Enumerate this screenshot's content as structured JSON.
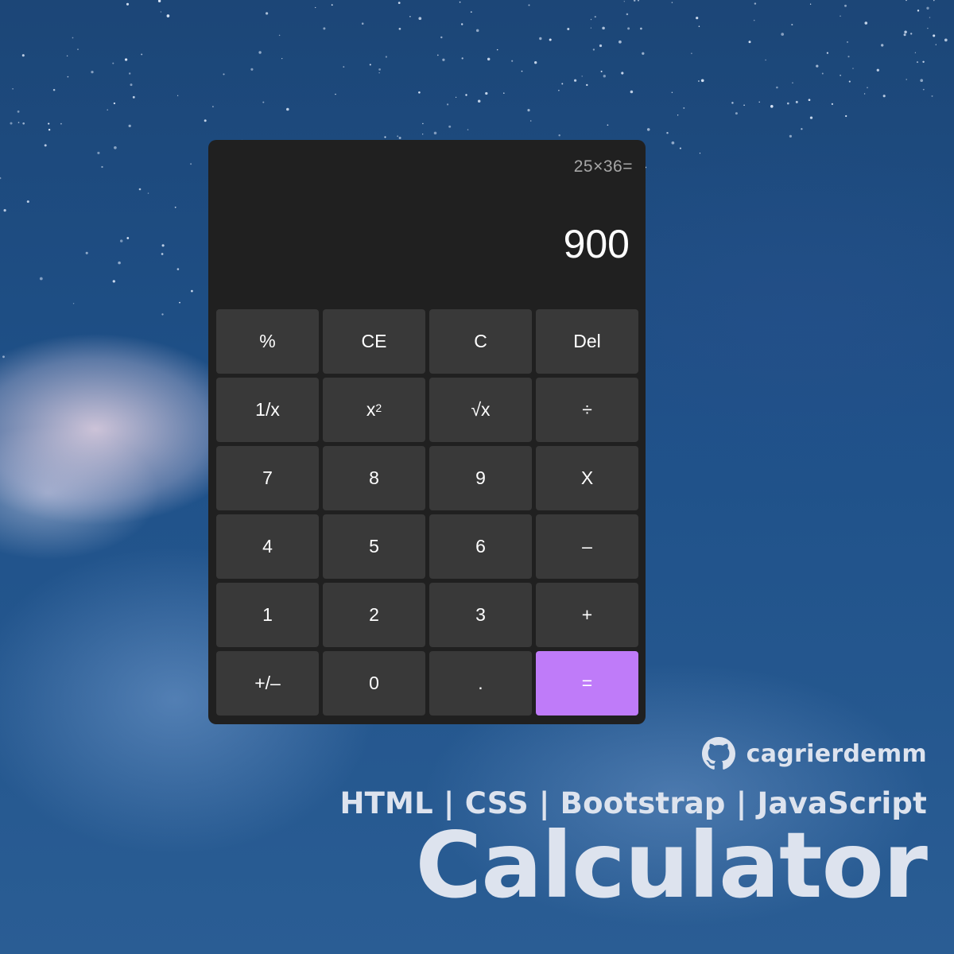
{
  "calculator": {
    "expression": "25×36=",
    "result": "900",
    "keys": [
      {
        "label": "%",
        "name": "percent"
      },
      {
        "label": "CE",
        "name": "clear-entry"
      },
      {
        "label": "C",
        "name": "clear"
      },
      {
        "label": "Del",
        "name": "delete"
      },
      {
        "label": "1/x",
        "name": "reciprocal"
      },
      {
        "label": "x",
        "sup": "2",
        "name": "square"
      },
      {
        "label": "√x",
        "name": "square-root"
      },
      {
        "label": "÷",
        "name": "divide"
      },
      {
        "label": "7",
        "name": "digit-7"
      },
      {
        "label": "8",
        "name": "digit-8"
      },
      {
        "label": "9",
        "name": "digit-9"
      },
      {
        "label": "X",
        "name": "multiply"
      },
      {
        "label": "4",
        "name": "digit-4"
      },
      {
        "label": "5",
        "name": "digit-5"
      },
      {
        "label": "6",
        "name": "digit-6"
      },
      {
        "label": "–",
        "name": "subtract"
      },
      {
        "label": "1",
        "name": "digit-1"
      },
      {
        "label": "2",
        "name": "digit-2"
      },
      {
        "label": "3",
        "name": "digit-3"
      },
      {
        "label": "+",
        "name": "add"
      },
      {
        "label": "+/–",
        "name": "negate"
      },
      {
        "label": "0",
        "name": "digit-0"
      },
      {
        "label": ".",
        "name": "decimal"
      },
      {
        "label": "=",
        "name": "equals"
      }
    ]
  },
  "credits": {
    "author": "cagrierdemm",
    "author_icon": "github-icon",
    "tech_stack": "HTML | CSS | Bootstrap | JavaScript",
    "title": "Calculator"
  },
  "colors": {
    "calculator_bg": "#202020",
    "key_bg": "#393939",
    "equals_accent": "#bf7bf9",
    "credit_text": "#dde3ee"
  }
}
